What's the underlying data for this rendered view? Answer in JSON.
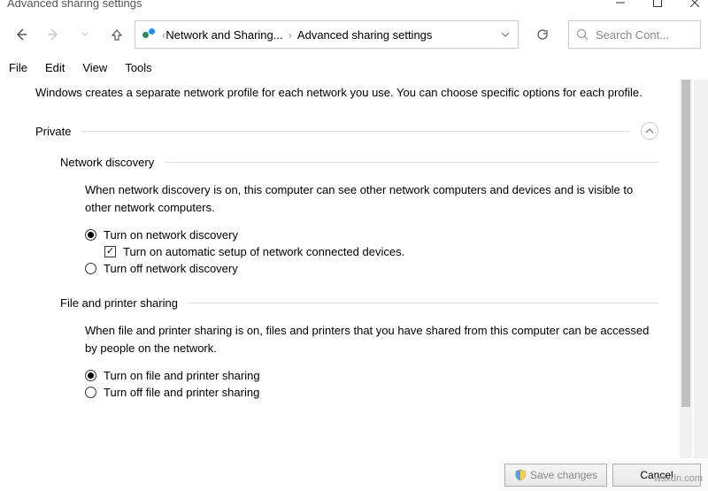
{
  "window": {
    "title": "Advanced sharing settings"
  },
  "breadcrumb": {
    "item1": "Network and Sharing...",
    "item2": "Advanced sharing settings"
  },
  "search": {
    "placeholder": "Search Cont..."
  },
  "menu": {
    "file": "File",
    "edit": "Edit",
    "view": "View",
    "tools": "Tools"
  },
  "content": {
    "intro": "Windows creates a separate network profile for each network you use. You can choose specific options for each profile.",
    "private": {
      "title": "Private",
      "network_discovery": {
        "title": "Network discovery",
        "desc": "When network discovery is on, this computer can see other network computers and devices and is visible to other network computers.",
        "option_on": "Turn on network discovery",
        "option_auto": "Turn on automatic setup of network connected devices.",
        "option_off": "Turn off network discovery"
      },
      "file_printer": {
        "title": "File and printer sharing",
        "desc": "When file and printer sharing is on, files and printers that you have shared from this computer can be accessed by people on the network.",
        "option_on": "Turn on file and printer sharing",
        "option_off": "Turn off file and printer sharing"
      }
    }
  },
  "footer": {
    "save": "Save changes",
    "cancel": "Cancel"
  },
  "watermark": "wsxdn.com"
}
